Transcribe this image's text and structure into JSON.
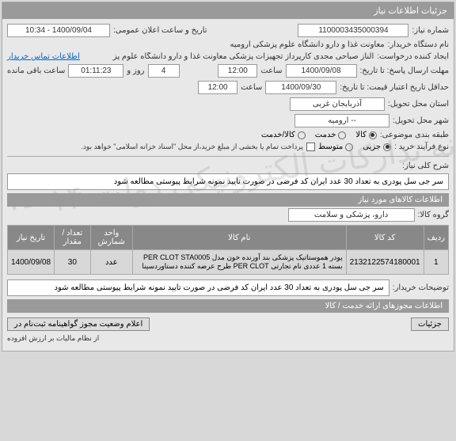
{
  "header": {
    "title": "جزئیات اطلاعات نیاز"
  },
  "fields": {
    "req_no_label": "شماره نیاز:",
    "req_no": "1100003435000394",
    "pub_datetime_label": "تاریخ و ساعت اعلان عمومی:",
    "pub_datetime": "1400/09/04 - 10:34",
    "buyer_label": "نام دستگاه خریدار:",
    "buyer": "معاونت غذا و دارو دانشگاه علوم پزشکی ارومیه",
    "creator_label": "ایجاد کننده درخواست:",
    "creator": "الناز صباحی مجدی کارپرداز تجهیزات پزشکی معاونت غذا و دارو دانشگاه علوم پز",
    "contact_link": "اطلاعات تماس خریدار",
    "deadline_label": "مهلت ارسال پاسخ: تا تاریخ:",
    "deadline_date": "1400/09/08",
    "time_label": "ساعت",
    "deadline_time": "12:00",
    "days": "4",
    "days_label": "روز و",
    "remain_time": "01:11:23",
    "remain_label": "ساعت باقی مانده",
    "min_valid_label": "حداقل تاریخ اعتبار قیمت: تا تاریخ:",
    "min_valid_date": "1400/09/30",
    "min_valid_time": "12:00",
    "province_label": "استان محل تحویل:",
    "province": "آذربایجان غربی",
    "city_label": "شهر محل تحویل:",
    "city": "-- ارومیه",
    "class_label": "طبقه بندی موضوعی:",
    "class_goods": "کالا",
    "class_service": "خدمت",
    "class_both": "کالا/خدمت",
    "purchase_type_label": "نوع فرآیند خرید :",
    "purchase_opt1": "جزیی",
    "purchase_opt2": "متوسط",
    "purchase_note": "پرداخت تمام یا بخشی از مبلغ خرید،از محل \"اسناد خزانه اسلامی\" خواهد بود.",
    "desc_label": "شرح کلی نیاز:",
    "desc": "سر جی سل پودری به تعداد 30 عدد ایران کد فرضی در صورت تایید نمونه شرایط پیوستی مطالعه شود",
    "goods_header": "اطلاعات کالاهای مورد نیاز",
    "group_label": "گروه کالا:",
    "group": "دارو، پزشکی و سلامت",
    "buyer_notes_label": "توضیحات خریدار:",
    "buyer_notes": "سر جی سل پودری به تعداد 30 عدد ایران کد فرضی در صورت تایید نمونه شرایط پیوستی مطالعه شود",
    "license_header": "اطلاعات مجوزهای ارائه خدمت / کالا",
    "details_btn": "جزئیات",
    "tax_btn": "اعلام وضعیت مجوز گواهینامه ثبت‌نام در",
    "iva_btn": "از نظام مالیات بر ارزش افزوده"
  },
  "table": {
    "headers": [
      "ردیف",
      "کد کالا",
      "نام کالا",
      "واحد شمارش",
      "تعداد / مقدار",
      "تاریخ نیاز"
    ],
    "rows": [
      {
        "idx": "1",
        "code": "2132122574180001",
        "name": "پودر هموستاتیک پزشکی بند آورنده خون مدل PER CLOT STA0005 بسته 1 عددی نام تجارتی PER CLOT طرح عرضه کننده دستاوردسینا",
        "unit": "عدد",
        "qty": "30",
        "date": "1400/09/08"
      }
    ]
  },
  "watermark": "سامانه تدارکات الکترونیکی دولت\n۰۱۴-۸۲۰۰۰"
}
